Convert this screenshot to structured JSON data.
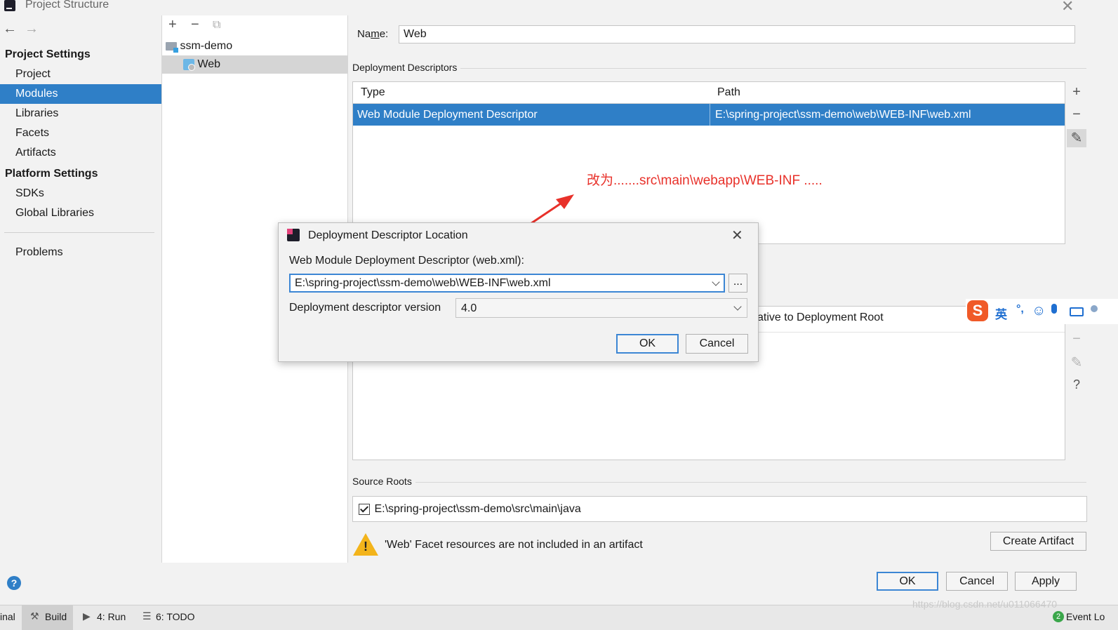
{
  "window": {
    "title": "Project Structure"
  },
  "left_nav": {
    "project_settings_header": "Project Settings",
    "project_settings": [
      {
        "label": "Project",
        "selected": false
      },
      {
        "label": "Modules",
        "selected": true
      },
      {
        "label": "Libraries",
        "selected": false
      },
      {
        "label": "Facets",
        "selected": false
      },
      {
        "label": "Artifacts",
        "selected": false
      }
    ],
    "platform_settings_header": "Platform Settings",
    "platform_settings": [
      {
        "label": "SDKs"
      },
      {
        "label": "Global Libraries"
      }
    ],
    "problems": "Problems"
  },
  "tree": {
    "items": [
      {
        "label": "ssm-demo",
        "icon": "module-folder-icon"
      },
      {
        "label": "Web",
        "icon": "web-facet-icon",
        "selected": true
      }
    ]
  },
  "right": {
    "name_label_pre": "Na",
    "name_label_mnemonic": "m",
    "name_label_post": "e:",
    "name_value": "Web",
    "deployment_descriptors_title": "Deployment Descriptors",
    "dd_columns": [
      "Type",
      "Path"
    ],
    "dd_row": {
      "type": "Web Module Deployment Descriptor",
      "path": "E:\\spring-project\\ssm-demo\\web\\WEB-INF\\web.xml"
    },
    "web_resource_partial": "ative to Deployment Root",
    "source_roots_title": "Source Roots",
    "source_root": {
      "checked": true,
      "path": "E:\\spring-project\\ssm-demo\\src\\main\\java"
    },
    "warning_text": "'Web' Facet resources are not included in an artifact",
    "create_artifact_label": "Create Artifact"
  },
  "footer": {
    "ok": "OK",
    "cancel": "Cancel",
    "apply": "Apply"
  },
  "statusbar": {
    "items": [
      "inal",
      "Build",
      "4: Run",
      "6: TODO"
    ],
    "event_log": "Event Lo",
    "event_count": "2",
    "watermark": "https://blog.csdn.net/u011066470"
  },
  "dialog": {
    "title": "Deployment Descriptor Location",
    "descriptor_label": "Web Module Deployment Descriptor (web.xml):",
    "descriptor_value": "E:\\spring-project\\ssm-demo\\web\\WEB-INF\\web.xml",
    "browse_label": "...",
    "version_label": "Deployment descriptor version",
    "version_value": "4.0",
    "ok": "OK",
    "cancel": "Cancel"
  },
  "annotation": {
    "text": "改为.......src\\main\\webapp\\WEB-INF .....",
    "color": "#e8312a"
  },
  "ime_toolbar": {
    "mode": "英",
    "punct": "°,"
  },
  "colors": {
    "selection": "#2f7fc7",
    "focus_border": "#3c86d4",
    "warning": "#f3b41b"
  }
}
